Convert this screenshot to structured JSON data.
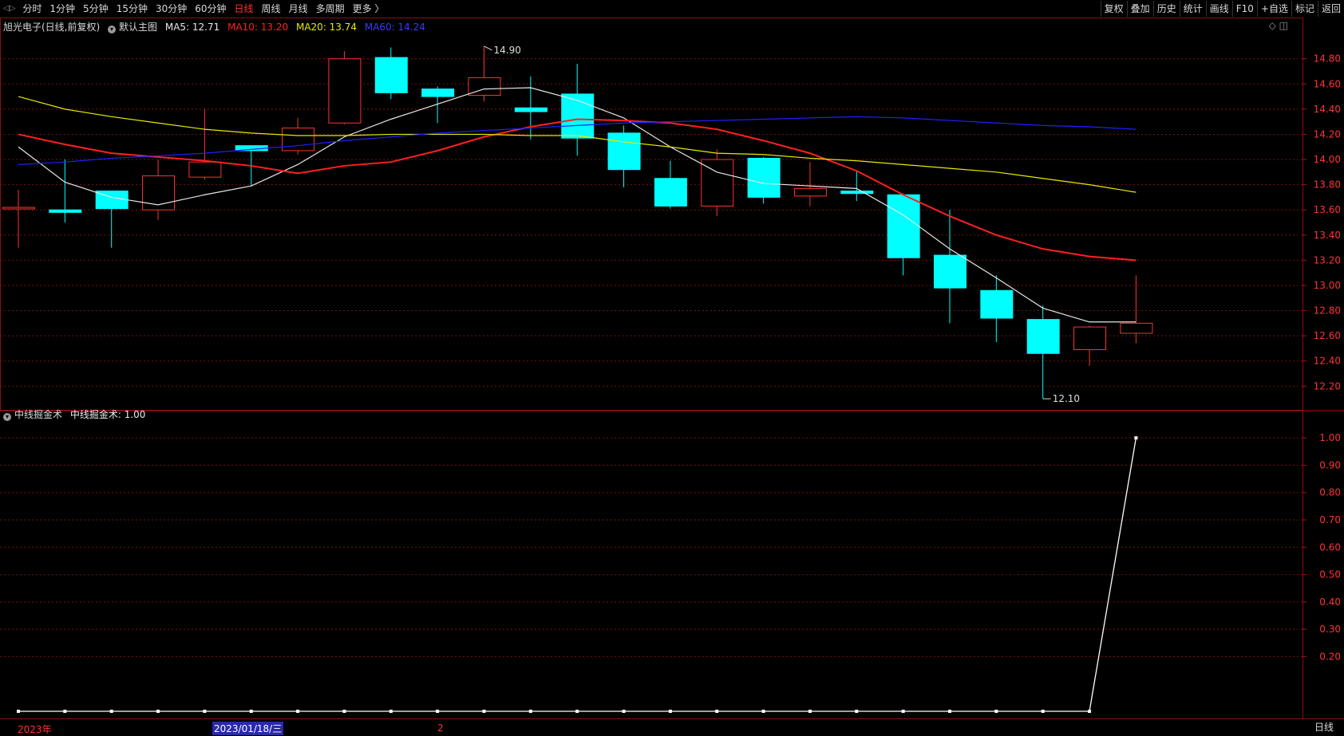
{
  "toolbar": {
    "arrows": "◁▷",
    "periods": [
      "分时",
      "1分钟",
      "5分钟",
      "15分钟",
      "30分钟",
      "60分钟",
      "日线",
      "周线",
      "月线",
      "多周期",
      "更多 〉"
    ],
    "active_period": "日线",
    "right_buttons": [
      "复权",
      "叠加",
      "历史",
      "统计",
      "画线",
      "F10",
      "+自选",
      "标记",
      "返回"
    ]
  },
  "main_legend": {
    "stock": "旭光电子(日线,前复权)",
    "template": "默认主图",
    "ma5": "MA5: 12.71",
    "ma10": "MA10: 13.20",
    "ma20": "MA20: 13.74",
    "ma60": "MA60: 14.24"
  },
  "sub_legend": {
    "name": "中线掘金术",
    "value_label": "中线掘金术: 1.00"
  },
  "main_corner": "◇ ◫",
  "high_marker": "14.90",
  "low_marker": "12.10",
  "date_bar": {
    "year_label": "2023年",
    "cursor_date": "2023/01/18/三",
    "mark2": "2"
  },
  "period_label": "日线",
  "colors": {
    "up": "#ff3232",
    "down": "#00ffff",
    "ma5": "#e8e8e8",
    "ma10": "#ff2020",
    "ma20": "#e8e800",
    "ma60": "#2020ff",
    "grid": "#7a1010",
    "axis_text": "#ff3232",
    "indicator": "#ffffff"
  },
  "chart_data": [
    {
      "type": "candlestick",
      "title": "旭光电子(日线,前复权)",
      "ylim": [
        12.05,
        14.95
      ],
      "yticks": [
        14.8,
        14.6,
        14.4,
        14.2,
        14.0,
        13.8,
        13.6,
        13.4,
        13.2,
        13.0,
        12.8,
        12.6,
        12.4,
        12.2
      ],
      "candles": [
        {
          "o": 13.61,
          "h": 13.76,
          "l": 13.3,
          "c": 13.62
        },
        {
          "o": 13.6,
          "h": 14.0,
          "l": 13.5,
          "c": 13.58
        },
        {
          "o": 13.75,
          "h": 13.75,
          "l": 13.3,
          "c": 13.61
        },
        {
          "o": 13.6,
          "h": 14.0,
          "l": 13.52,
          "c": 13.87
        },
        {
          "o": 13.86,
          "h": 14.4,
          "l": 13.84,
          "c": 13.98
        },
        {
          "o": 14.11,
          "h": 14.11,
          "l": 13.79,
          "c": 14.07
        },
        {
          "o": 14.07,
          "h": 14.33,
          "l": 14.04,
          "c": 14.25
        },
        {
          "o": 14.29,
          "h": 14.86,
          "l": 14.28,
          "c": 14.8
        },
        {
          "o": 14.81,
          "h": 14.89,
          "l": 14.48,
          "c": 14.53
        },
        {
          "o": 14.56,
          "h": 14.58,
          "l": 14.29,
          "c": 14.5
        },
        {
          "o": 14.51,
          "h": 14.9,
          "l": 14.46,
          "c": 14.65
        },
        {
          "o": 14.41,
          "h": 14.66,
          "l": 14.16,
          "c": 14.38
        },
        {
          "o": 14.52,
          "h": 14.76,
          "l": 14.03,
          "c": 14.17
        },
        {
          "o": 14.21,
          "h": 14.27,
          "l": 13.78,
          "c": 13.92
        },
        {
          "o": 13.85,
          "h": 13.99,
          "l": 13.61,
          "c": 13.63
        },
        {
          "o": 13.63,
          "h": 14.08,
          "l": 13.55,
          "c": 14.0
        },
        {
          "o": 14.01,
          "h": 14.02,
          "l": 13.65,
          "c": 13.7
        },
        {
          "o": 13.71,
          "h": 13.98,
          "l": 13.63,
          "c": 13.77
        },
        {
          "o": 13.75,
          "h": 13.91,
          "l": 13.67,
          "c": 13.73
        },
        {
          "o": 13.72,
          "h": 13.73,
          "l": 13.08,
          "c": 13.22
        },
        {
          "o": 13.24,
          "h": 13.6,
          "l": 12.7,
          "c": 12.98
        },
        {
          "o": 12.96,
          "h": 13.08,
          "l": 12.55,
          "c": 12.74
        },
        {
          "o": 12.73,
          "h": 12.84,
          "l": 12.1,
          "c": 12.46
        },
        {
          "o": 12.49,
          "h": 12.68,
          "l": 12.36,
          "c": 12.67
        },
        {
          "o": 12.62,
          "h": 13.08,
          "l": 12.54,
          "c": 12.7
        }
      ],
      "series": [
        {
          "name": "MA5",
          "values": [
            14.1,
            13.82,
            13.7,
            13.64,
            13.72,
            13.79,
            13.96,
            14.18,
            14.32,
            14.44,
            14.56,
            14.57,
            14.47,
            14.33,
            14.1,
            13.9,
            13.81,
            13.79,
            13.77,
            13.56,
            13.29,
            13.06,
            12.82,
            12.71,
            12.71
          ]
        },
        {
          "name": "MA10",
          "values": [
            14.2,
            14.12,
            14.05,
            14.02,
            13.99,
            13.95,
            13.89,
            13.95,
            13.98,
            14.07,
            14.18,
            14.26,
            14.32,
            14.31,
            14.29,
            14.24,
            14.15,
            14.05,
            13.91,
            13.72,
            13.55,
            13.4,
            13.29,
            13.23,
            13.2
          ]
        },
        {
          "name": "MA20",
          "values": [
            14.5,
            14.4,
            14.34,
            14.29,
            14.24,
            14.21,
            14.19,
            14.19,
            14.2,
            14.2,
            14.2,
            14.19,
            14.19,
            14.14,
            14.1,
            14.05,
            14.04,
            14.01,
            13.99,
            13.96,
            13.93,
            13.9,
            13.85,
            13.8,
            13.74
          ]
        },
        {
          "name": "MA60",
          "values": [
            13.96,
            13.98,
            14.01,
            14.03,
            14.05,
            14.08,
            14.11,
            14.15,
            14.18,
            14.21,
            14.23,
            14.25,
            14.27,
            14.29,
            14.3,
            14.31,
            14.32,
            14.33,
            14.34,
            14.33,
            14.31,
            14.29,
            14.27,
            14.26,
            14.24
          ]
        }
      ]
    },
    {
      "type": "line",
      "title": "中线掘金术",
      "ylim": [
        0,
        1.05
      ],
      "yticks": [
        1.0,
        0.9,
        0.8,
        0.7,
        0.6,
        0.5,
        0.4,
        0.3,
        0.2
      ],
      "series": [
        {
          "name": "中线掘金术",
          "values": [
            0,
            0,
            0,
            0,
            0,
            0,
            0,
            0,
            0,
            0,
            0,
            0,
            0,
            0,
            0,
            0,
            0,
            0,
            0,
            0,
            0,
            0,
            0,
            0,
            1.0
          ]
        }
      ]
    }
  ]
}
